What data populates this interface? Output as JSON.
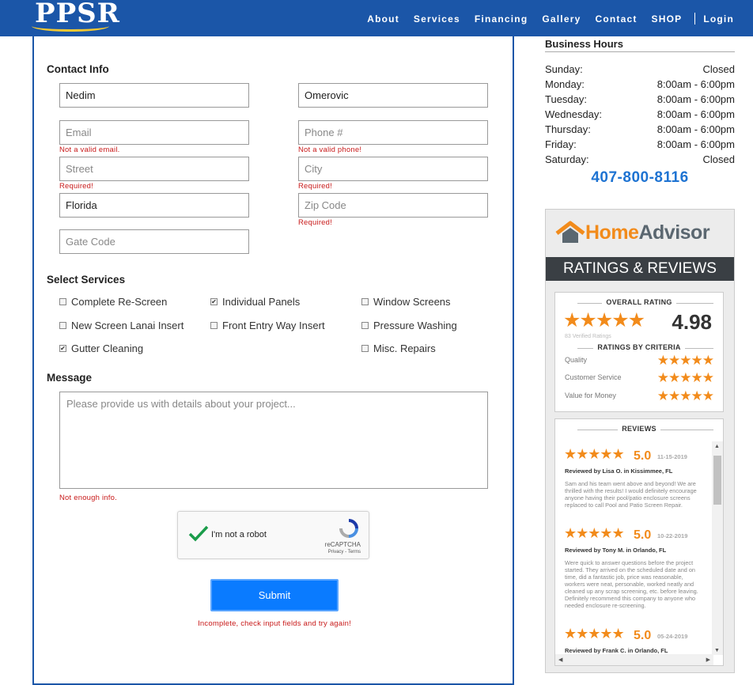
{
  "header": {
    "logo_text": "PPSR",
    "nav": [
      "About",
      "Services",
      "Financing",
      "Gallery",
      "Contact",
      "SHOP"
    ],
    "login": "Login"
  },
  "form": {
    "contact_title": "Contact Info",
    "first_name_value": "Nedim",
    "last_name_value": "Omerovic",
    "email_placeholder": "Email",
    "email_error": "Not a valid email.",
    "phone_placeholder": "Phone #",
    "phone_error": "Not a valid phone!",
    "street_placeholder": "Street",
    "street_error": "Required!",
    "city_placeholder": "City",
    "city_error": "Required!",
    "state_value": "Florida",
    "zip_placeholder": "Zip Code",
    "zip_error": "Required!",
    "gate_placeholder": "Gate Code",
    "services_title": "Select Services",
    "services": [
      {
        "label": "Complete Re-Screen",
        "checked": false
      },
      {
        "label": "Individual Panels",
        "checked": true
      },
      {
        "label": "Window Screens",
        "checked": false
      },
      {
        "label": "New Screen Lanai Insert",
        "checked": false
      },
      {
        "label": "Front Entry Way Insert",
        "checked": false
      },
      {
        "label": "Pressure Washing",
        "checked": false
      },
      {
        "label": "Gutter Cleaning",
        "checked": true
      },
      {
        "label": "Misc. Repairs",
        "checked": false
      }
    ],
    "message_title": "Message",
    "message_placeholder": "Please provide us with details about your project...",
    "message_error": "Not enough info.",
    "captcha_label": "I'm not a robot",
    "captcha_brand": "reCAPTCHA",
    "captcha_links": "Privacy - Terms",
    "submit_label": "Submit",
    "submit_error": "Incomplete, check input fields and try again!"
  },
  "hours": {
    "title": "Business Hours",
    "rows": [
      {
        "day": "Sunday:",
        "time": "Closed"
      },
      {
        "day": "Monday:",
        "time": "8:00am - 6:00pm"
      },
      {
        "day": "Tuesday:",
        "time": "8:00am - 6:00pm"
      },
      {
        "day": "Wednesday:",
        "time": "8:00am - 6:00pm"
      },
      {
        "day": "Thursday:",
        "time": "8:00am - 6:00pm"
      },
      {
        "day": "Friday:",
        "time": "8:00am - 6:00pm"
      },
      {
        "day": "Saturday:",
        "time": "Closed"
      }
    ],
    "phone": "407-800-8116"
  },
  "homeadvisor": {
    "brand_home": "Home",
    "brand_advisor": "Advisor",
    "banner": "RATINGS & REVIEWS",
    "overall_heading": "OVERALL RATING",
    "overall_value": "4.98",
    "verified": "83 Verified Ratings",
    "criteria_heading": "RATINGS BY CRITERIA",
    "criteria": [
      "Quality",
      "Customer Service",
      "Value for Money"
    ],
    "reviews_heading": "REVIEWS",
    "reviews": [
      {
        "score": "5.0",
        "date": "11-15-2019",
        "by": "Reviewed by Lisa O. in Kissimmee, FL",
        "body": "Sam and his team went above and beyond! We are thrilled with the results! I would definitely encourage anyone having their pool/patio enclosure screens replaced to call Pool and Patio Screen Repair."
      },
      {
        "score": "5.0",
        "date": "10-22-2019",
        "by": "Reviewed by Tony M. in Orlando, FL",
        "body": "Were quick to answer questions before the project started. They arrived on the scheduled date and on time, did a fantastic job, price was reasonable, workers were neat, personable, worked neatly and cleaned up any scrap screening, etc. before leaving. Definitely recommend this company to anyone who needed enclosure re-screening."
      },
      {
        "score": "5.0",
        "date": "05-24-2019",
        "by": "Reviewed by Frank C. in Orlando, FL",
        "body": ""
      }
    ],
    "accent_color": "#f28b1b"
  }
}
